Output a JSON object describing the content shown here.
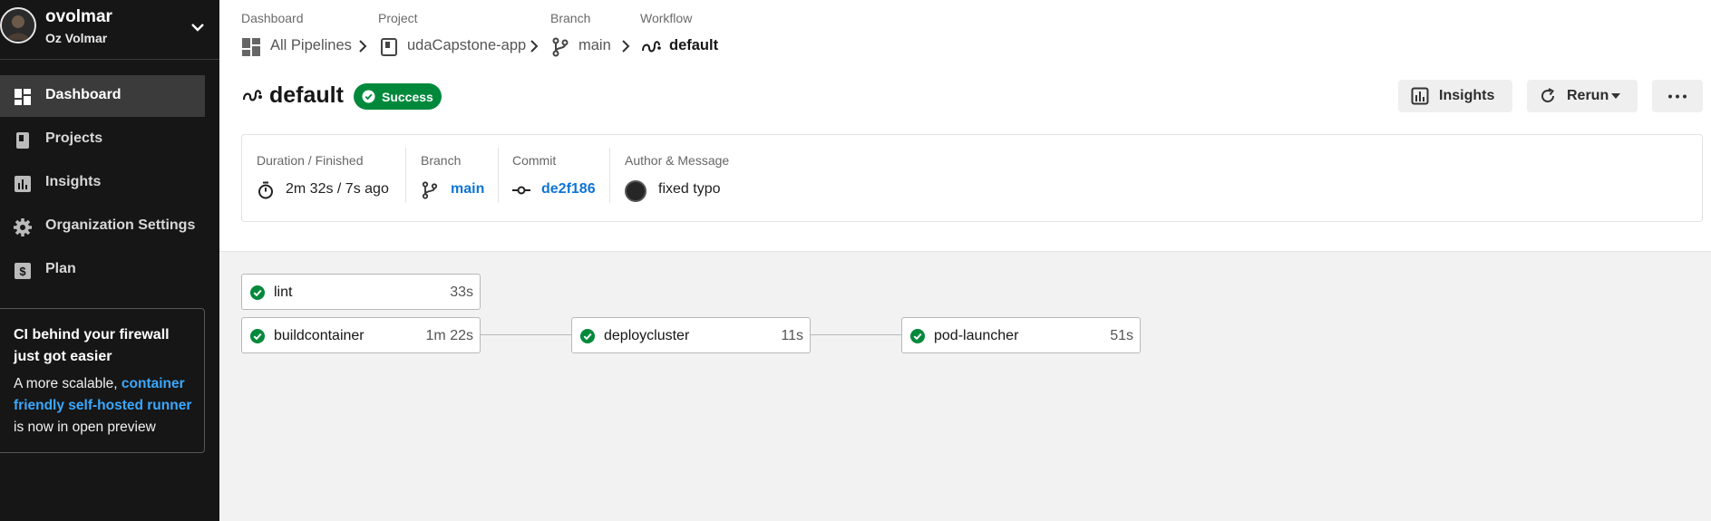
{
  "org": {
    "name": "ovolmar",
    "user": "Oz Volmar"
  },
  "nav": {
    "items": [
      {
        "label": "Dashboard",
        "icon": "dashboard-icon",
        "active": true
      },
      {
        "label": "Projects",
        "icon": "projects-icon"
      },
      {
        "label": "Insights",
        "icon": "insights-icon"
      },
      {
        "label": "Organization Settings",
        "icon": "gear-icon"
      },
      {
        "label": "Plan",
        "icon": "dollar-icon"
      }
    ]
  },
  "promo": {
    "title": "CI behind your firewall just got easier",
    "body_before": "A more scalable,",
    "link": "container friendly self-hosted runner",
    "body_after": "is now in open preview"
  },
  "breadcrumb": {
    "dashboard_label": "Dashboard",
    "dashboard_value": "All Pipelines",
    "project_label": "Project",
    "project_value": "udaCapstone-app",
    "branch_label": "Branch",
    "branch_value": "main",
    "workflow_label": "Workflow",
    "workflow_value": "default"
  },
  "workflow": {
    "title": "default",
    "status": "Success",
    "status_color": "#00893b"
  },
  "actions": {
    "insights": "Insights",
    "rerun": "Rerun",
    "more": "⋯"
  },
  "summary": {
    "duration_label": "Duration / Finished",
    "duration_value": "2m 32s / 7s ago",
    "branch_label": "Branch",
    "branch_value": "main",
    "commit_label": "Commit",
    "commit_value": "de2f186",
    "author_label": "Author & Message",
    "author_message": "fixed typo"
  },
  "jobs": [
    {
      "name": "lint",
      "duration": "33s",
      "status": "success"
    },
    {
      "name": "buildcontainer",
      "duration": "1m 22s",
      "status": "success"
    },
    {
      "name": "deploycluster",
      "duration": "11s",
      "status": "success"
    },
    {
      "name": "pod-launcher",
      "duration": "51s",
      "status": "success"
    }
  ]
}
